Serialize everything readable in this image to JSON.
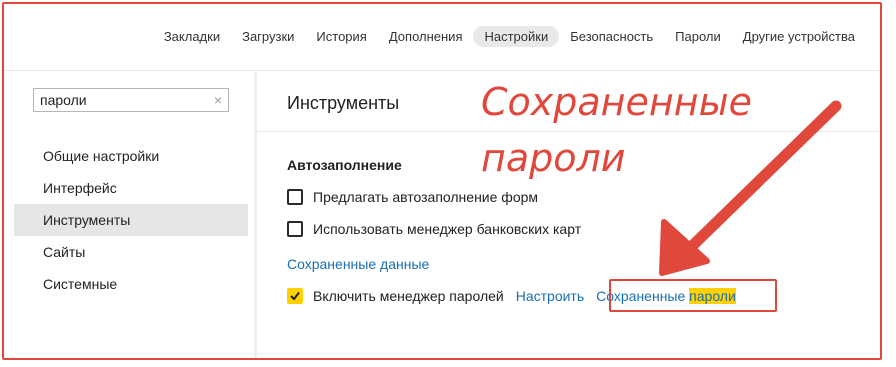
{
  "nav": {
    "tabs": [
      {
        "label": "Закладки",
        "active": false
      },
      {
        "label": "Загрузки",
        "active": false
      },
      {
        "label": "История",
        "active": false
      },
      {
        "label": "Дополнения",
        "active": false
      },
      {
        "label": "Настройки",
        "active": true
      },
      {
        "label": "Безопасность",
        "active": false
      },
      {
        "label": "Пароли",
        "active": false
      },
      {
        "label": "Другие устройства",
        "active": false
      }
    ]
  },
  "sidebar": {
    "search": {
      "value": "пароли",
      "clear_icon": "×"
    },
    "items": [
      {
        "label": "Общие настройки",
        "active": false
      },
      {
        "label": "Интерфейс",
        "active": false
      },
      {
        "label": "Инструменты",
        "active": true
      },
      {
        "label": "Сайты",
        "active": false
      },
      {
        "label": "Системные",
        "active": false
      }
    ]
  },
  "main": {
    "title": "Инструменты",
    "section_title": "Автозаполнение",
    "options": [
      {
        "label": "Предлагать автозаполнение форм",
        "checked": false
      },
      {
        "label": "Использовать менеджер банковских карт",
        "checked": false
      }
    ],
    "saved_data_link": "Сохраненные данные",
    "password_manager": {
      "label": "Включить менеджер паролей",
      "checked": true,
      "configure_link": "Настроить",
      "saved_passwords_link_prefix": "Сохраненные",
      "saved_passwords_link_highlight": "пароли"
    }
  },
  "annotation": {
    "line1": "Сохраненные",
    "line2": "пароли"
  },
  "colors": {
    "accent_red": "#e0483c",
    "link_blue": "#1a6fb0",
    "checkbox_yellow": "#ffd100"
  }
}
